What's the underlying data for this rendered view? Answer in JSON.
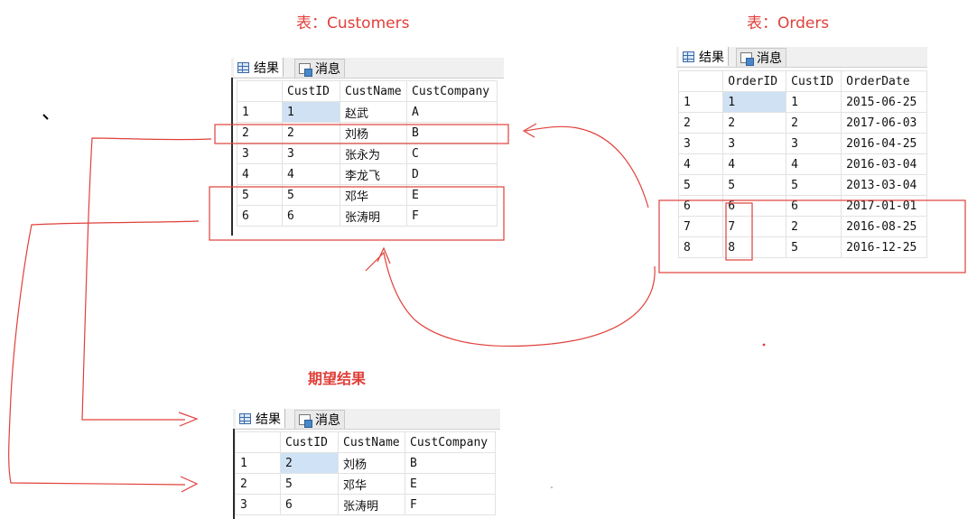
{
  "captions": {
    "customers": "表：Customers",
    "orders": "表：Orders",
    "expected": "期望结果"
  },
  "tabs": {
    "results": "结果",
    "messages": "消息"
  },
  "customers": {
    "columns": [
      "",
      "CustID",
      "CustName",
      "CustCompany"
    ],
    "rows": [
      [
        "1",
        "1",
        "赵武",
        "A"
      ],
      [
        "2",
        "2",
        "刘杨",
        "B"
      ],
      [
        "3",
        "3",
        "张永为",
        "C"
      ],
      [
        "4",
        "4",
        "李龙飞",
        "D"
      ],
      [
        "5",
        "5",
        "邓华",
        "E"
      ],
      [
        "6",
        "6",
        "张涛明",
        "F"
      ]
    ]
  },
  "orders": {
    "columns": [
      "",
      "OrderID",
      "CustID",
      "OrderDate"
    ],
    "rows": [
      [
        "1",
        "1",
        "1",
        "2015-06-25"
      ],
      [
        "2",
        "2",
        "2",
        "2017-06-03"
      ],
      [
        "3",
        "3",
        "3",
        "2016-04-25"
      ],
      [
        "4",
        "4",
        "4",
        "2016-03-04"
      ],
      [
        "5",
        "5",
        "5",
        "2013-03-04"
      ],
      [
        "6",
        "6",
        "6",
        "2017-01-01"
      ],
      [
        "7",
        "7",
        "2",
        "2016-08-25"
      ],
      [
        "8",
        "8",
        "5",
        "2016-12-25"
      ]
    ]
  },
  "expected": {
    "columns": [
      "",
      "CustID",
      "CustName",
      "CustCompany"
    ],
    "rows": [
      [
        "1",
        "2",
        "刘杨",
        "B"
      ],
      [
        "2",
        "5",
        "邓华",
        "E"
      ],
      [
        "3",
        "6",
        "张涛明",
        "F"
      ]
    ]
  },
  "colors": {
    "annotation": "#e0403a",
    "selection": "#cfe1f3"
  }
}
